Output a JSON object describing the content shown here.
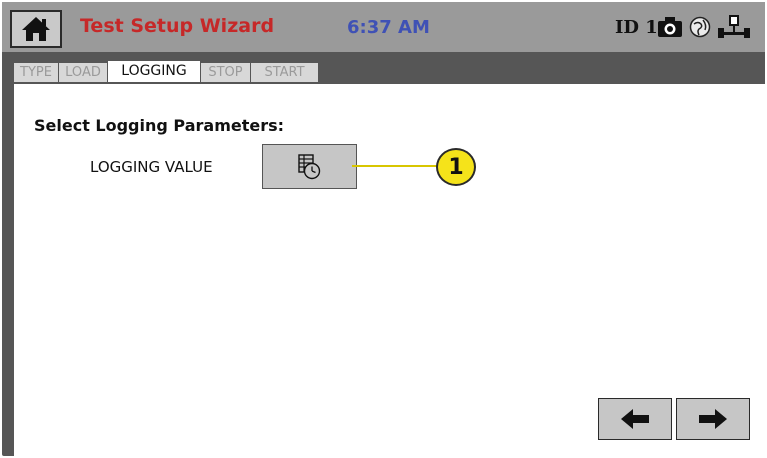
{
  "header": {
    "title": "Test Setup Wizard",
    "time": "6:37 AM",
    "id_label": "ID 1",
    "icons": [
      "home-icon",
      "camera-icon",
      "network-icon",
      "usb-icon"
    ],
    "title_color": "#c62828",
    "time_color": "#3f51b5"
  },
  "tabs": [
    {
      "label": "TYPE",
      "active": false
    },
    {
      "label": "LOAD",
      "active": false
    },
    {
      "label": "LOGGING",
      "active": true
    },
    {
      "label": "STOP",
      "active": false
    },
    {
      "label": "START",
      "active": false
    }
  ],
  "main": {
    "section_title": "Select Logging Parameters:",
    "logging_value_label": "LOGGING VALUE",
    "logging_value_icon": "clock-table-icon",
    "callout_number": "1"
  },
  "navigation": {
    "back_icon": "arrow-left-icon",
    "next_icon": "arrow-right-icon"
  }
}
